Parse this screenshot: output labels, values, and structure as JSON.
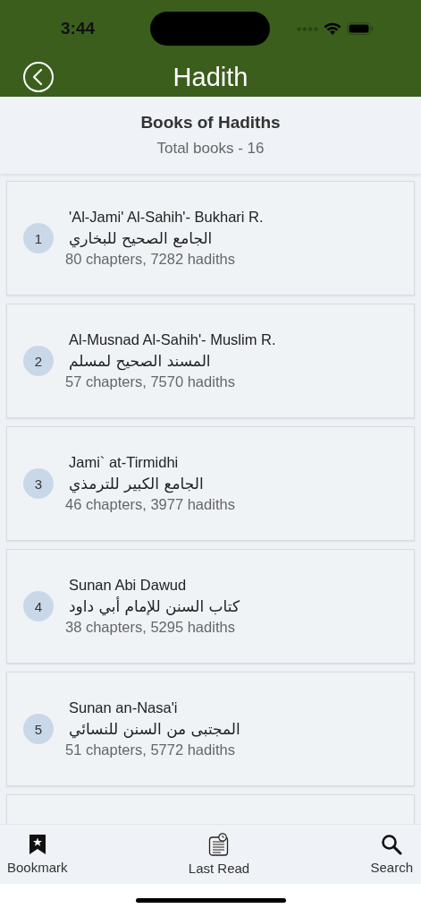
{
  "status_bar": {
    "time": "3:44"
  },
  "nav_bar": {
    "title": "Hadith"
  },
  "summary": {
    "heading": "Books of Hadiths",
    "subtitle": "Total books - 16"
  },
  "books": [
    {
      "number": "1",
      "title": "'Al-Jami' Al-Sahih'- Bukhari R.",
      "arabic_title": "الجامع الصحيح للبخاري",
      "stats": "80 chapters,  7282 hadiths"
    },
    {
      "number": "2",
      "title": "Al-Musnad Al-Sahih'- Muslim R.",
      "arabic_title": "المسند الصحيح لمسلم",
      "stats": "57 chapters,  7570 hadiths"
    },
    {
      "number": "3",
      "title": "Jami` at-Tirmidhi",
      "arabic_title": "الجامع الكبير للترمذي",
      "stats": "46 chapters,  3977 hadiths"
    },
    {
      "number": "4",
      "title": "Sunan Abi Dawud",
      "arabic_title": "كتاب السنن للإمام أبي داود",
      "stats": "38 chapters,  5295 hadiths"
    },
    {
      "number": "5",
      "title": "Sunan an-Nasa'i",
      "arabic_title": "المجتبى من السنن للنسائي",
      "stats": "51 chapters,  5772 hadiths"
    }
  ],
  "tab_bar": [
    {
      "kind": "bookmark",
      "label": "Bookmark"
    },
    {
      "kind": "last_read",
      "label": "Last Read"
    },
    {
      "kind": "search",
      "label": "Search"
    }
  ]
}
